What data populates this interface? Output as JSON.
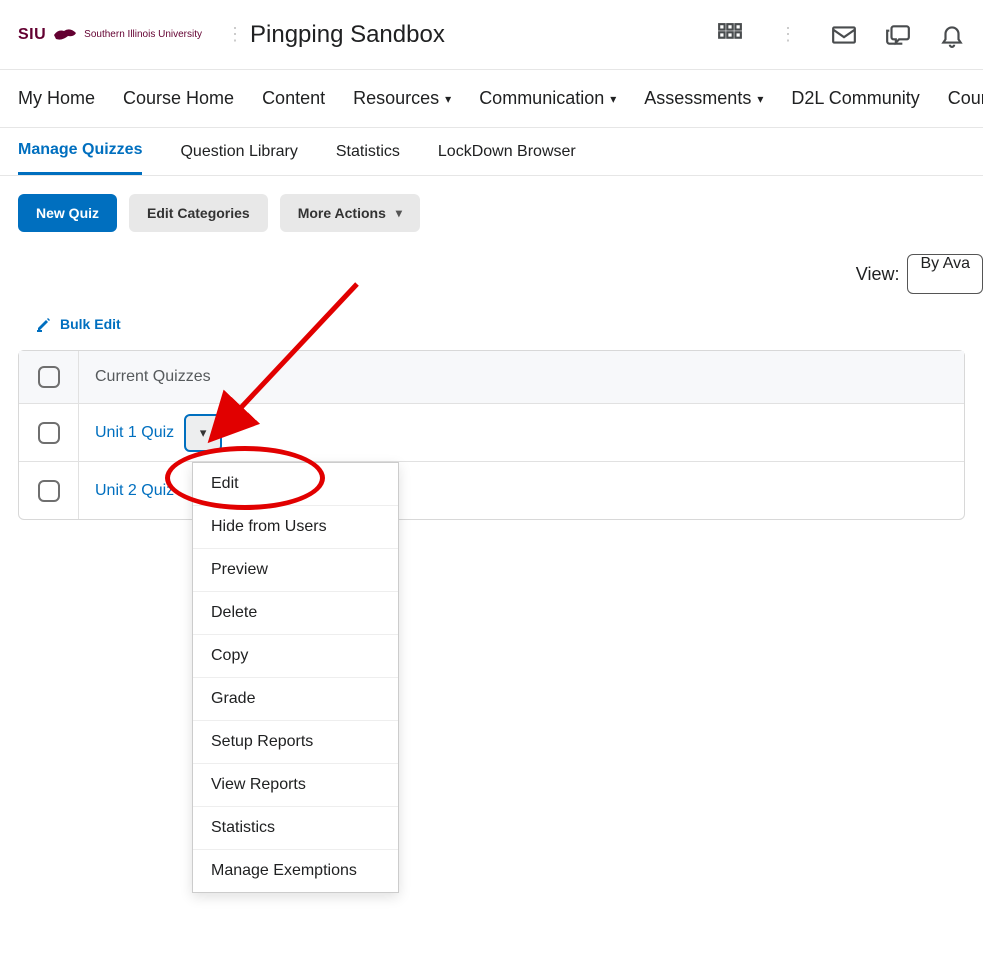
{
  "header": {
    "logo_text": "SIU",
    "logo_sub": "Southern Illinois University",
    "course_title": "Pingping Sandbox"
  },
  "nav": {
    "items": [
      "My Home",
      "Course Home",
      "Content",
      "Resources",
      "Communication",
      "Assessments",
      "D2L Community",
      "Course Admin"
    ],
    "dropdowns": [
      false,
      false,
      false,
      true,
      true,
      true,
      false,
      false
    ]
  },
  "subtabs": {
    "items": [
      "Manage Quizzes",
      "Question Library",
      "Statistics",
      "LockDown Browser"
    ],
    "active_index": 0
  },
  "actions": {
    "new_quiz": "New Quiz",
    "edit_categories": "Edit Categories",
    "more_actions": "More Actions"
  },
  "view": {
    "label": "View:",
    "selected": "By Ava"
  },
  "bulk": {
    "label": "Bulk Edit"
  },
  "table": {
    "header": "Current Quizzes",
    "rows": [
      {
        "name": "Unit 1 Quiz",
        "open": true
      },
      {
        "name": "Unit 2 Quiz",
        "open": false
      }
    ]
  },
  "dropdown": {
    "items": [
      "Edit",
      "Hide from Users",
      "Preview",
      "Delete",
      "Copy",
      "Grade",
      "Setup Reports",
      "View Reports",
      "Statistics",
      "Manage Exemptions"
    ]
  },
  "colors": {
    "primary": "#006fbf",
    "accent_red": "#e10000",
    "logo": "#630031"
  }
}
